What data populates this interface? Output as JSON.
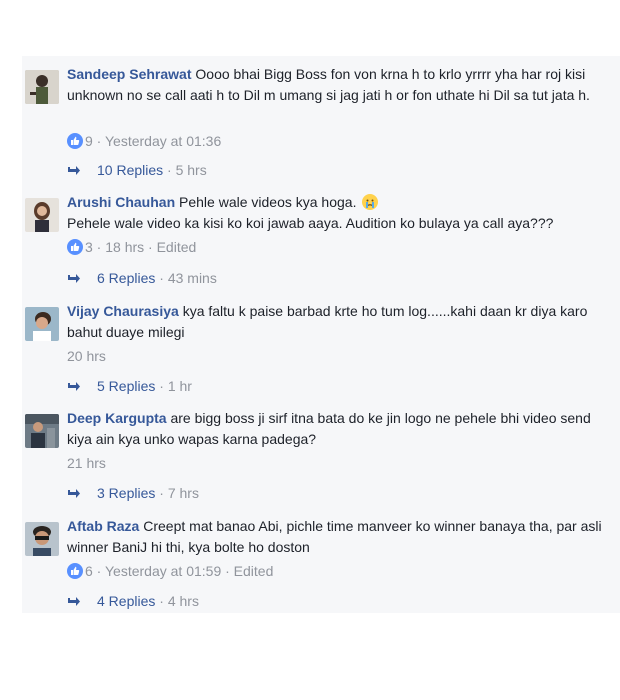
{
  "comments": [
    {
      "author": "Sandeep Sehrawat",
      "text": " Oooo bhai Bigg Boss fon von krna h to krlo yrrrr yha har roj kisi unknown no se call aati h to Dil m umang si jag jati h or fon uthate hi Dil sa tut jata h.",
      "likes": "9",
      "meta": " · Yesterday at 01:36",
      "replies": "10 Replies",
      "replies_time": " · 5 hrs"
    },
    {
      "author": "Arushi Chauhan",
      "text": " Pehle wale videos kya hoga.",
      "text2": "Pehele wale video ka kisi ko koi jawab aaya. Audition ko bulaya ya call aya???",
      "emoji": "crying-face-icon",
      "likes": "3",
      "meta": " · 18 hrs · Edited",
      "replies": "6 Replies",
      "replies_time": " · 43 mins"
    },
    {
      "author": "Vijay Chaurasiya",
      "text": " kya faltu k paise barbad krte ho tum log......kahi daan kr diya karo bahut duaye milegi",
      "meta": "20 hrs",
      "replies": "5 Replies",
      "replies_time": " · 1 hr"
    },
    {
      "author": "Deep Kargupta",
      "text": " are bigg boss ji sirf itna bata do ke jin logo ne pehele bhi video send kiya ain kya unko wapas karna padega?",
      "meta": "21 hrs",
      "replies": "3 Replies",
      "replies_time": " · 7 hrs"
    },
    {
      "author": "Aftab Raza",
      "text": " Creept mat banao Abi, pichle time manveer ko winner banaya tha, par asli winner BaniJ hi thi, kya bolte ho doston",
      "likes": "6",
      "meta": " · Yesterday at 01:59 · Edited",
      "replies": "4 Replies",
      "replies_time": " · 4 hrs"
    }
  ],
  "colors": {
    "link": "#365899",
    "meta": "#90949c",
    "like": "#5890ff",
    "panel": "#f6f7f9"
  },
  "icons": {
    "like": "thumbs-up-icon",
    "reply": "reply-arrow-icon"
  }
}
